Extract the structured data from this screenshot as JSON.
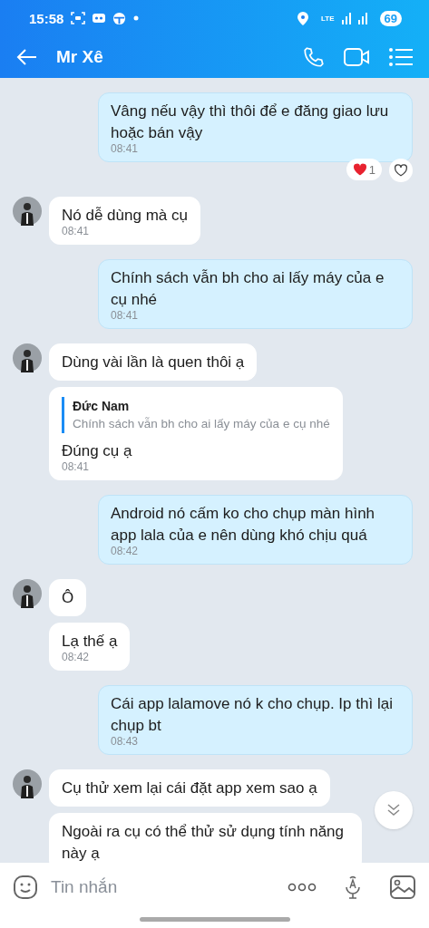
{
  "status_bar": {
    "time": "15:58",
    "network": "LTE",
    "battery": "69"
  },
  "header": {
    "title": "Mr Xê"
  },
  "messages": [
    {
      "kind": "outgoing",
      "text": "Vâng nếu vậy thì thôi để e đăng giao lưu hoặc bán vậy",
      "time": "08:41",
      "reaction": {
        "count": "1"
      }
    },
    {
      "kind": "incoming",
      "avatar": true,
      "text": "Nó dễ dùng mà cụ",
      "time": "08:41"
    },
    {
      "kind": "outgoing",
      "text": "Chính sách vẫn bh cho ai lấy máy của e cụ nhé",
      "time": "08:41"
    },
    {
      "kind": "incoming",
      "avatar": true,
      "text": "Dùng vài lần là quen thôi ạ"
    },
    {
      "kind": "incoming",
      "avatar": false,
      "quote": {
        "author": "Đức Nam",
        "text": "Chính sách vẫn bh cho ai lấy máy của e cụ nhé"
      },
      "text": "Đúng cụ ạ",
      "time": "08:41"
    },
    {
      "kind": "outgoing",
      "text": "Android nó cấm ko cho chụp màn hình app lala của e nên dùng khó chịu quá",
      "time": "08:42"
    },
    {
      "kind": "incoming",
      "avatar": true,
      "text": "Ô"
    },
    {
      "kind": "incoming",
      "avatar": false,
      "text": "Lạ thế ạ",
      "time": "08:42"
    },
    {
      "kind": "outgoing",
      "text": "Cái app lalamove nó k cho chụp. Ip thì lại chụp bt",
      "time": "08:43"
    },
    {
      "kind": "incoming",
      "avatar": true,
      "text": "Cụ thử xem lại cái đặt app xem sao ạ"
    },
    {
      "kind": "incoming",
      "avatar": false,
      "text": "Ngoài ra cụ có thể thử sử dụng tính năng này ạ"
    }
  ],
  "composer": {
    "placeholder": "Tin nhắn"
  }
}
